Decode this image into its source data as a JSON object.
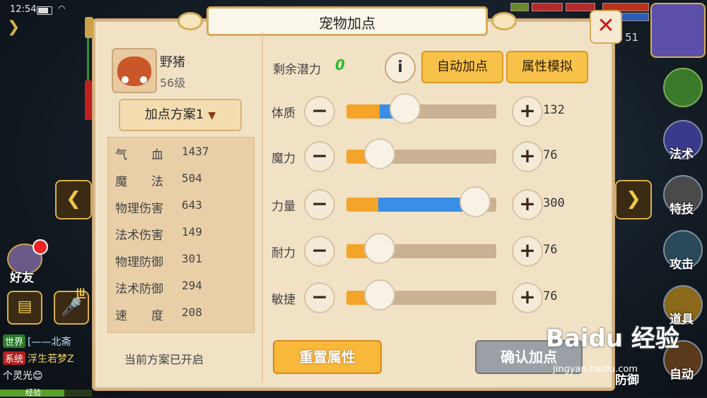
{
  "status_bar": {
    "time": "12:54"
  },
  "panel": {
    "title": "宠物加点",
    "pet": {
      "name": "野猪",
      "level": "56级"
    },
    "plan_button": "加点方案1",
    "stats": [
      {
        "label": "气　　血",
        "value": "1437"
      },
      {
        "label": "魔　　法",
        "value": "504"
      },
      {
        "label": "物理伤害",
        "value": "643"
      },
      {
        "label": "法术伤害",
        "value": "149"
      },
      {
        "label": "物理防御",
        "value": "301"
      },
      {
        "label": "法术防御",
        "value": "294"
      },
      {
        "label": "速　　度",
        "value": "208"
      }
    ],
    "plan_status": "当前方案已开启",
    "potential_label": "剩余潜力",
    "potential_value": "0",
    "info_icon": "i",
    "auto_button": "自动加点",
    "simulate_button": "属性模拟",
    "attributes": [
      {
        "name": "体质",
        "value": "132",
        "base_pct": 0.22,
        "add_pct": 0.38
      },
      {
        "name": "魔力",
        "value": "76",
        "base_pct": 0.21,
        "add_pct": 0.21
      },
      {
        "name": "力量",
        "value": "300",
        "base_pct": 0.21,
        "add_pct": 0.85
      },
      {
        "name": "耐力",
        "value": "76",
        "base_pct": 0.21,
        "add_pct": 0.21
      },
      {
        "name": "敏捷",
        "value": "76",
        "base_pct": 0.21,
        "add_pct": 0.21
      }
    ],
    "reset_button": "重置属性",
    "confirm_button": "确认加点"
  },
  "game_hud": {
    "friend_label": "好友",
    "mic_tag": "世",
    "chat_lines": [
      {
        "tag": "世界",
        "tag_color": "#2a7a2a",
        "text": "[——北斋",
        "text_color": "#bfe3ff"
      },
      {
        "tag": "系统",
        "tag_color": "#b02020",
        "text": "浮生若梦Z",
        "text_color": "#f0d060"
      },
      {
        "tag": "",
        "tag_color": "",
        "text": "个灵光😊",
        "text_color": "#ffffff"
      }
    ],
    "exp_label": "经验",
    "level_badge": "51",
    "right_buttons": [
      "",
      "法术",
      "特技",
      "攻击",
      "道具",
      "自动"
    ],
    "under_label": "防御"
  },
  "watermark": {
    "logo": "Baidu 经验",
    "url": "jingyan.baidu.com"
  }
}
